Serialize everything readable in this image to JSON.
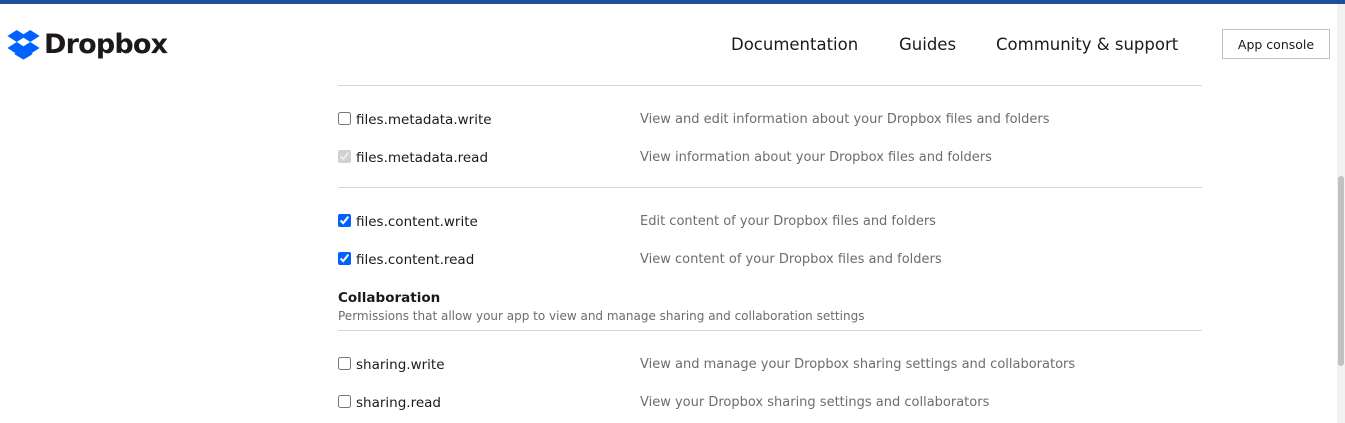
{
  "header": {
    "logo_text": "Dropbox",
    "nav": [
      {
        "label": "Documentation"
      },
      {
        "label": "Guides"
      },
      {
        "label": "Community & support"
      }
    ],
    "app_console_label": "App console"
  },
  "permissions": {
    "files_metadata": [
      {
        "name": "files.metadata.write",
        "description": "View and edit information about your Dropbox files and folders",
        "checked": false,
        "disabled": false
      },
      {
        "name": "files.metadata.read",
        "description": "View information about your Dropbox files and folders",
        "checked": true,
        "disabled": true
      }
    ],
    "files_content": [
      {
        "name": "files.content.write",
        "description": "Edit content of your Dropbox files and folders",
        "checked": true,
        "disabled": false
      },
      {
        "name": "files.content.read",
        "description": "View content of your Dropbox files and folders",
        "checked": true,
        "disabled": false
      }
    ],
    "collaboration": {
      "title": "Collaboration",
      "subtitle": "Permissions that allow your app to view and manage sharing and collaboration settings",
      "items": [
        {
          "name": "sharing.write",
          "description": "View and manage your Dropbox sharing settings and collaborators",
          "checked": false,
          "disabled": false
        },
        {
          "name": "sharing.read",
          "description": "View your Dropbox sharing settings and collaborators",
          "checked": false,
          "disabled": false
        }
      ]
    }
  },
  "colors": {
    "accent": "#0061fe",
    "top_bar": "#1f4e9e",
    "text": "#1e1919",
    "muted": "#6f6c6a"
  }
}
